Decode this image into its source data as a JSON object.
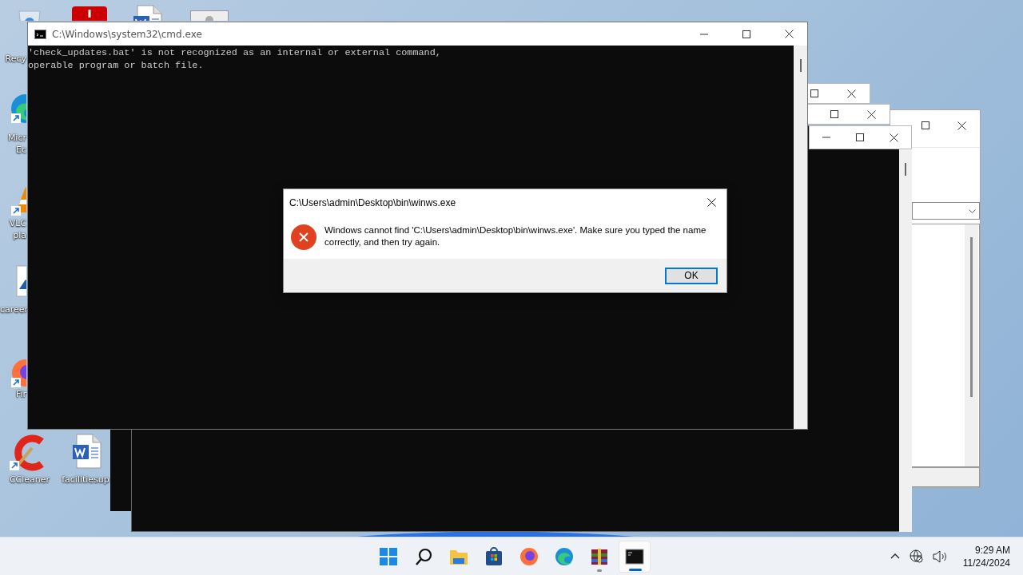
{
  "desktop": {
    "icons": [
      {
        "kind": "recycle",
        "label_lines": [
          "Recy"
        ]
      },
      {
        "kind": "pdf"
      },
      {
        "kind": "word"
      },
      {
        "kind": "settings"
      },
      {
        "kind": "edge",
        "label_lines": [
          "Micr",
          "Ec"
        ]
      },
      {
        "kind": "vlc",
        "label_lines": [
          "VLC",
          "pla"
        ]
      },
      {
        "kind": "image",
        "label_lines": [
          "career"
        ]
      },
      {
        "kind": "firefox",
        "label_lines": [
          "Fir"
        ]
      },
      {
        "kind": "ccleaner",
        "label_lines": [
          "CCleaner"
        ]
      },
      {
        "kind": "word",
        "label_lines": [
          "facilitiesup"
        ]
      }
    ]
  },
  "console_window": {
    "title": "C:\\Windows\\system32\\cmd.exe",
    "lines": [
      "'check_updates.bat' is not recognized as an internal or external command,",
      "operable program or batch file."
    ]
  },
  "error_dialog": {
    "title": "C:\\Users\\admin\\Desktop\\bin\\winws.exe",
    "message": "Windows cannot find 'C:\\Users\\admin\\Desktop\\bin\\winws.exe'. Make sure you typed the name correctly, and then try again.",
    "buttons": [
      "OK"
    ]
  },
  "taskbar": {
    "apps": [
      {
        "kind": "start",
        "running": false,
        "active": false
      },
      {
        "kind": "search",
        "running": false,
        "active": false
      },
      {
        "kind": "explorer",
        "running": false,
        "active": false
      },
      {
        "kind": "store",
        "running": false,
        "active": false
      },
      {
        "kind": "firefox",
        "running": false,
        "active": false
      },
      {
        "kind": "edge",
        "running": false,
        "active": false
      },
      {
        "kind": "winrar",
        "running": true,
        "active": false
      },
      {
        "kind": "terminal",
        "running": true,
        "active": true
      }
    ],
    "clock": {
      "time": "9:29 AM",
      "date": "11/24/2024"
    }
  }
}
